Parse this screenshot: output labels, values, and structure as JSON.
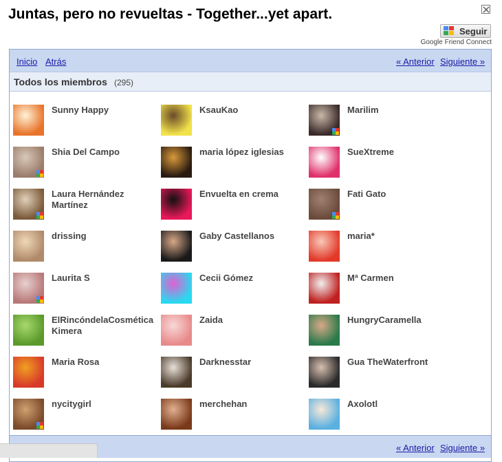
{
  "header": {
    "title": "Juntas, pero no revueltas - Together...yet apart.",
    "follow_label": "Seguir",
    "gfc_label": "Google Friend Connect"
  },
  "nav": {
    "inicio": "Inicio",
    "atras": "Atrás",
    "anterior": "« Anterior",
    "siguiente": "Siguiente »"
  },
  "section": {
    "title": "Todos los miembros",
    "count": "(295)"
  },
  "members": [
    {
      "name": "Sunny Happy",
      "c1": "#e8742a",
      "c2": "#fff2d8",
      "gbadge": false
    },
    {
      "name": "KsauKao",
      "c1": "#f2e24a",
      "c2": "#6a4a2a",
      "gbadge": false
    },
    {
      "name": "Marilim",
      "c1": "#3a2a2a",
      "c2": "#c9b9a8",
      "gbadge": true
    },
    {
      "name": "Shia Del Campo",
      "c1": "#9a7c6a",
      "c2": "#d8c8b8",
      "gbadge": true
    },
    {
      "name": "maria lópez iglesias",
      "c1": "#2a1a10",
      "c2": "#d89a3a",
      "gbadge": false
    },
    {
      "name": "SueXtreme",
      "c1": "#e0306a",
      "c2": "#ffffff",
      "gbadge": false
    },
    {
      "name": "Laura Hernández Martínez",
      "c1": "#7a5a3a",
      "c2": "#e0d0b8",
      "gbadge": true
    },
    {
      "name": "Envuelta en crema",
      "c1": "#e8185a",
      "c2": "#111111",
      "gbadge": false
    },
    {
      "name": "Fati Gato",
      "c1": "#6a4a3a",
      "c2": "#a08070",
      "gbadge": true
    },
    {
      "name": "drissing",
      "c1": "#b08a6a",
      "c2": "#f0d8b8",
      "gbadge": false
    },
    {
      "name": "Gaby Castellanos",
      "c1": "#1a1a1a",
      "c2": "#d8a888",
      "gbadge": false
    },
    {
      "name": "maria*",
      "c1": "#e23a2a",
      "c2": "#f8c8b8",
      "gbadge": false
    },
    {
      "name": "Laurita S",
      "c1": "#b87878",
      "c2": "#e8d0d0",
      "gbadge": true
    },
    {
      "name": "Cecii Gómez",
      "c1": "#2ad8f0",
      "c2": "#e060d0",
      "gbadge": false
    },
    {
      "name": "Mª Carmen",
      "c1": "#c02020",
      "c2": "#f0f0f0",
      "gbadge": false
    },
    {
      "name": "ElRincóndelaCosmética Kimera",
      "c1": "#5a9a2a",
      "c2": "#a8d870",
      "gbadge": false
    },
    {
      "name": "Zaida",
      "c1": "#e88a8a",
      "c2": "#f8d8d8",
      "gbadge": false
    },
    {
      "name": "HungryCaramella",
      "c1": "#2a7a4a",
      "c2": "#d8a888",
      "gbadge": false
    },
    {
      "name": "Maria Rosa",
      "c1": "#d83a2a",
      "c2": "#f0a020",
      "gbadge": false
    },
    {
      "name": "Darknesstar",
      "c1": "#4a3a2a",
      "c2": "#e8e0d8",
      "gbadge": false
    },
    {
      "name": "Gua TheWaterfront",
      "c1": "#2a2a2a",
      "c2": "#d8c0b0",
      "gbadge": false
    },
    {
      "name": "nycitygirl",
      "c1": "#7a4a2a",
      "c2": "#d0a070",
      "gbadge": true
    },
    {
      "name": "merchehan",
      "c1": "#7a3a1a",
      "c2": "#e0b090",
      "gbadge": false
    },
    {
      "name": "Axolotl",
      "c1": "#5ab0e0",
      "c2": "#f8e8d8",
      "gbadge": false
    }
  ]
}
